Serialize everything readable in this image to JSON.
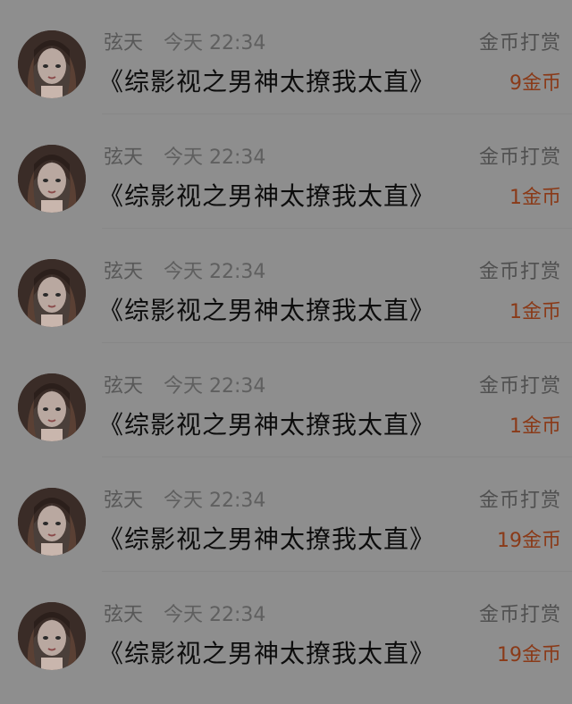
{
  "rewards": [
    {
      "user": "弦天",
      "time": "今天 22:34",
      "book_title": "《综影视之男神太撩我太直》",
      "label": "金币打赏",
      "amount": "9金币"
    },
    {
      "user": "弦天",
      "time": "今天 22:34",
      "book_title": "《综影视之男神太撩我太直》",
      "label": "金币打赏",
      "amount": "1金币"
    },
    {
      "user": "弦天",
      "time": "今天 22:34",
      "book_title": "《综影视之男神太撩我太直》",
      "label": "金币打赏",
      "amount": "1金币"
    },
    {
      "user": "弦天",
      "time": "今天 22:34",
      "book_title": "《综影视之男神太撩我太直》",
      "label": "金币打赏",
      "amount": "1金币"
    },
    {
      "user": "弦天",
      "time": "今天 22:34",
      "book_title": "《综影视之男神太撩我太直》",
      "label": "金币打赏",
      "amount": "19金币"
    },
    {
      "user": "弦天",
      "time": "今天 22:34",
      "book_title": "《综影视之男神太撩我太直》",
      "label": "金币打赏",
      "amount": "19金币"
    }
  ],
  "icons": {
    "avatar": "user-avatar-icon"
  },
  "colors": {
    "background": "#8e8e8e",
    "amount": "#8a3a18",
    "title": "#0d0d0d",
    "meta": "#585858"
  }
}
